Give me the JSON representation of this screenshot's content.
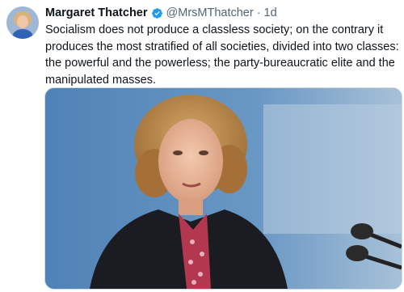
{
  "author": {
    "name": "Margaret Thatcher",
    "handle": "@MrsMThatcher",
    "separator": "·",
    "time": "1d",
    "verified_color": "#1d9bf0"
  },
  "tweet": {
    "text": "Socialism does not produce a classless society; on the contrary it produces the most stratified of all societies, divided into two classes: the powerful and the powerless; the party-bureaucratic elite and the manipulated masses."
  },
  "icons": {
    "verified": "verified-badge-icon"
  },
  "media": {
    "description_colors": {
      "background": "#5b8bb8",
      "hair": "#b98a4a",
      "jacket": "#1b1b22",
      "scarf": "#b3384f"
    }
  }
}
